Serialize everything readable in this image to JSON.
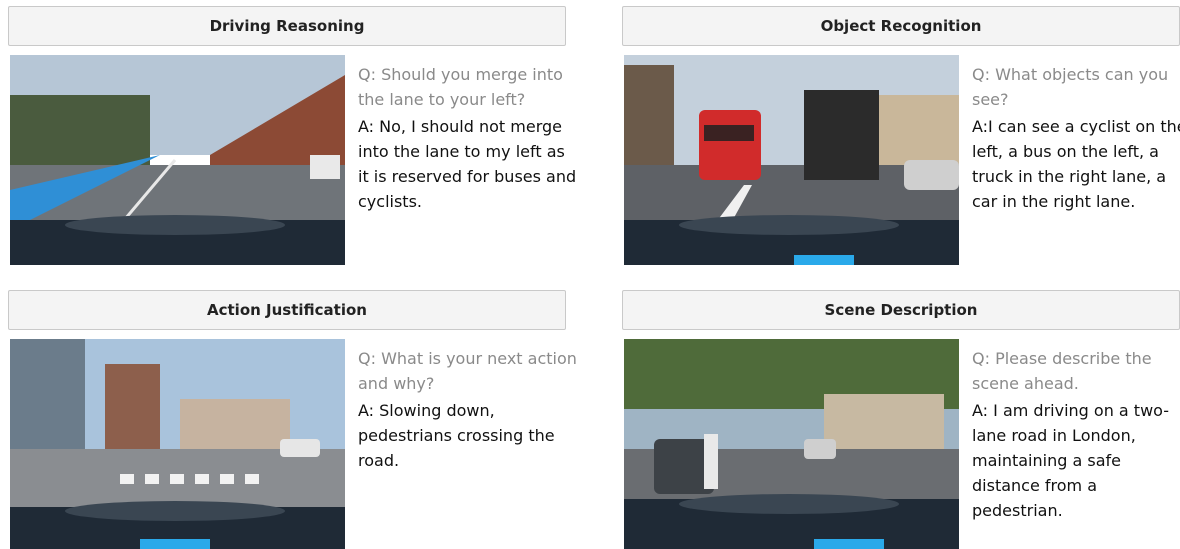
{
  "panels": [
    {
      "title": "Driving Reasoning",
      "question": "Q: Should you merge into the lane to your left?",
      "answer": "A: No, I should not merge into the lane to my left as it is reserved for buses and cyclists."
    },
    {
      "title": "Object Recognition",
      "question": "Q: What objects can you see?",
      "answer": "A:I can see a cyclist on the left, a bus on the left, a truck in the right lane, a car in the right lane."
    },
    {
      "title": "Action Justification",
      "question": "Q: What is your next action and why?",
      "answer": "A: Slowing down, pedestrians crossing the road."
    },
    {
      "title": "Scene Description",
      "question": "Q: Please describe the scene ahead.",
      "answer": "A: I am driving on a two-lane road in London, maintaining a safe distance from a pedestrian."
    }
  ]
}
